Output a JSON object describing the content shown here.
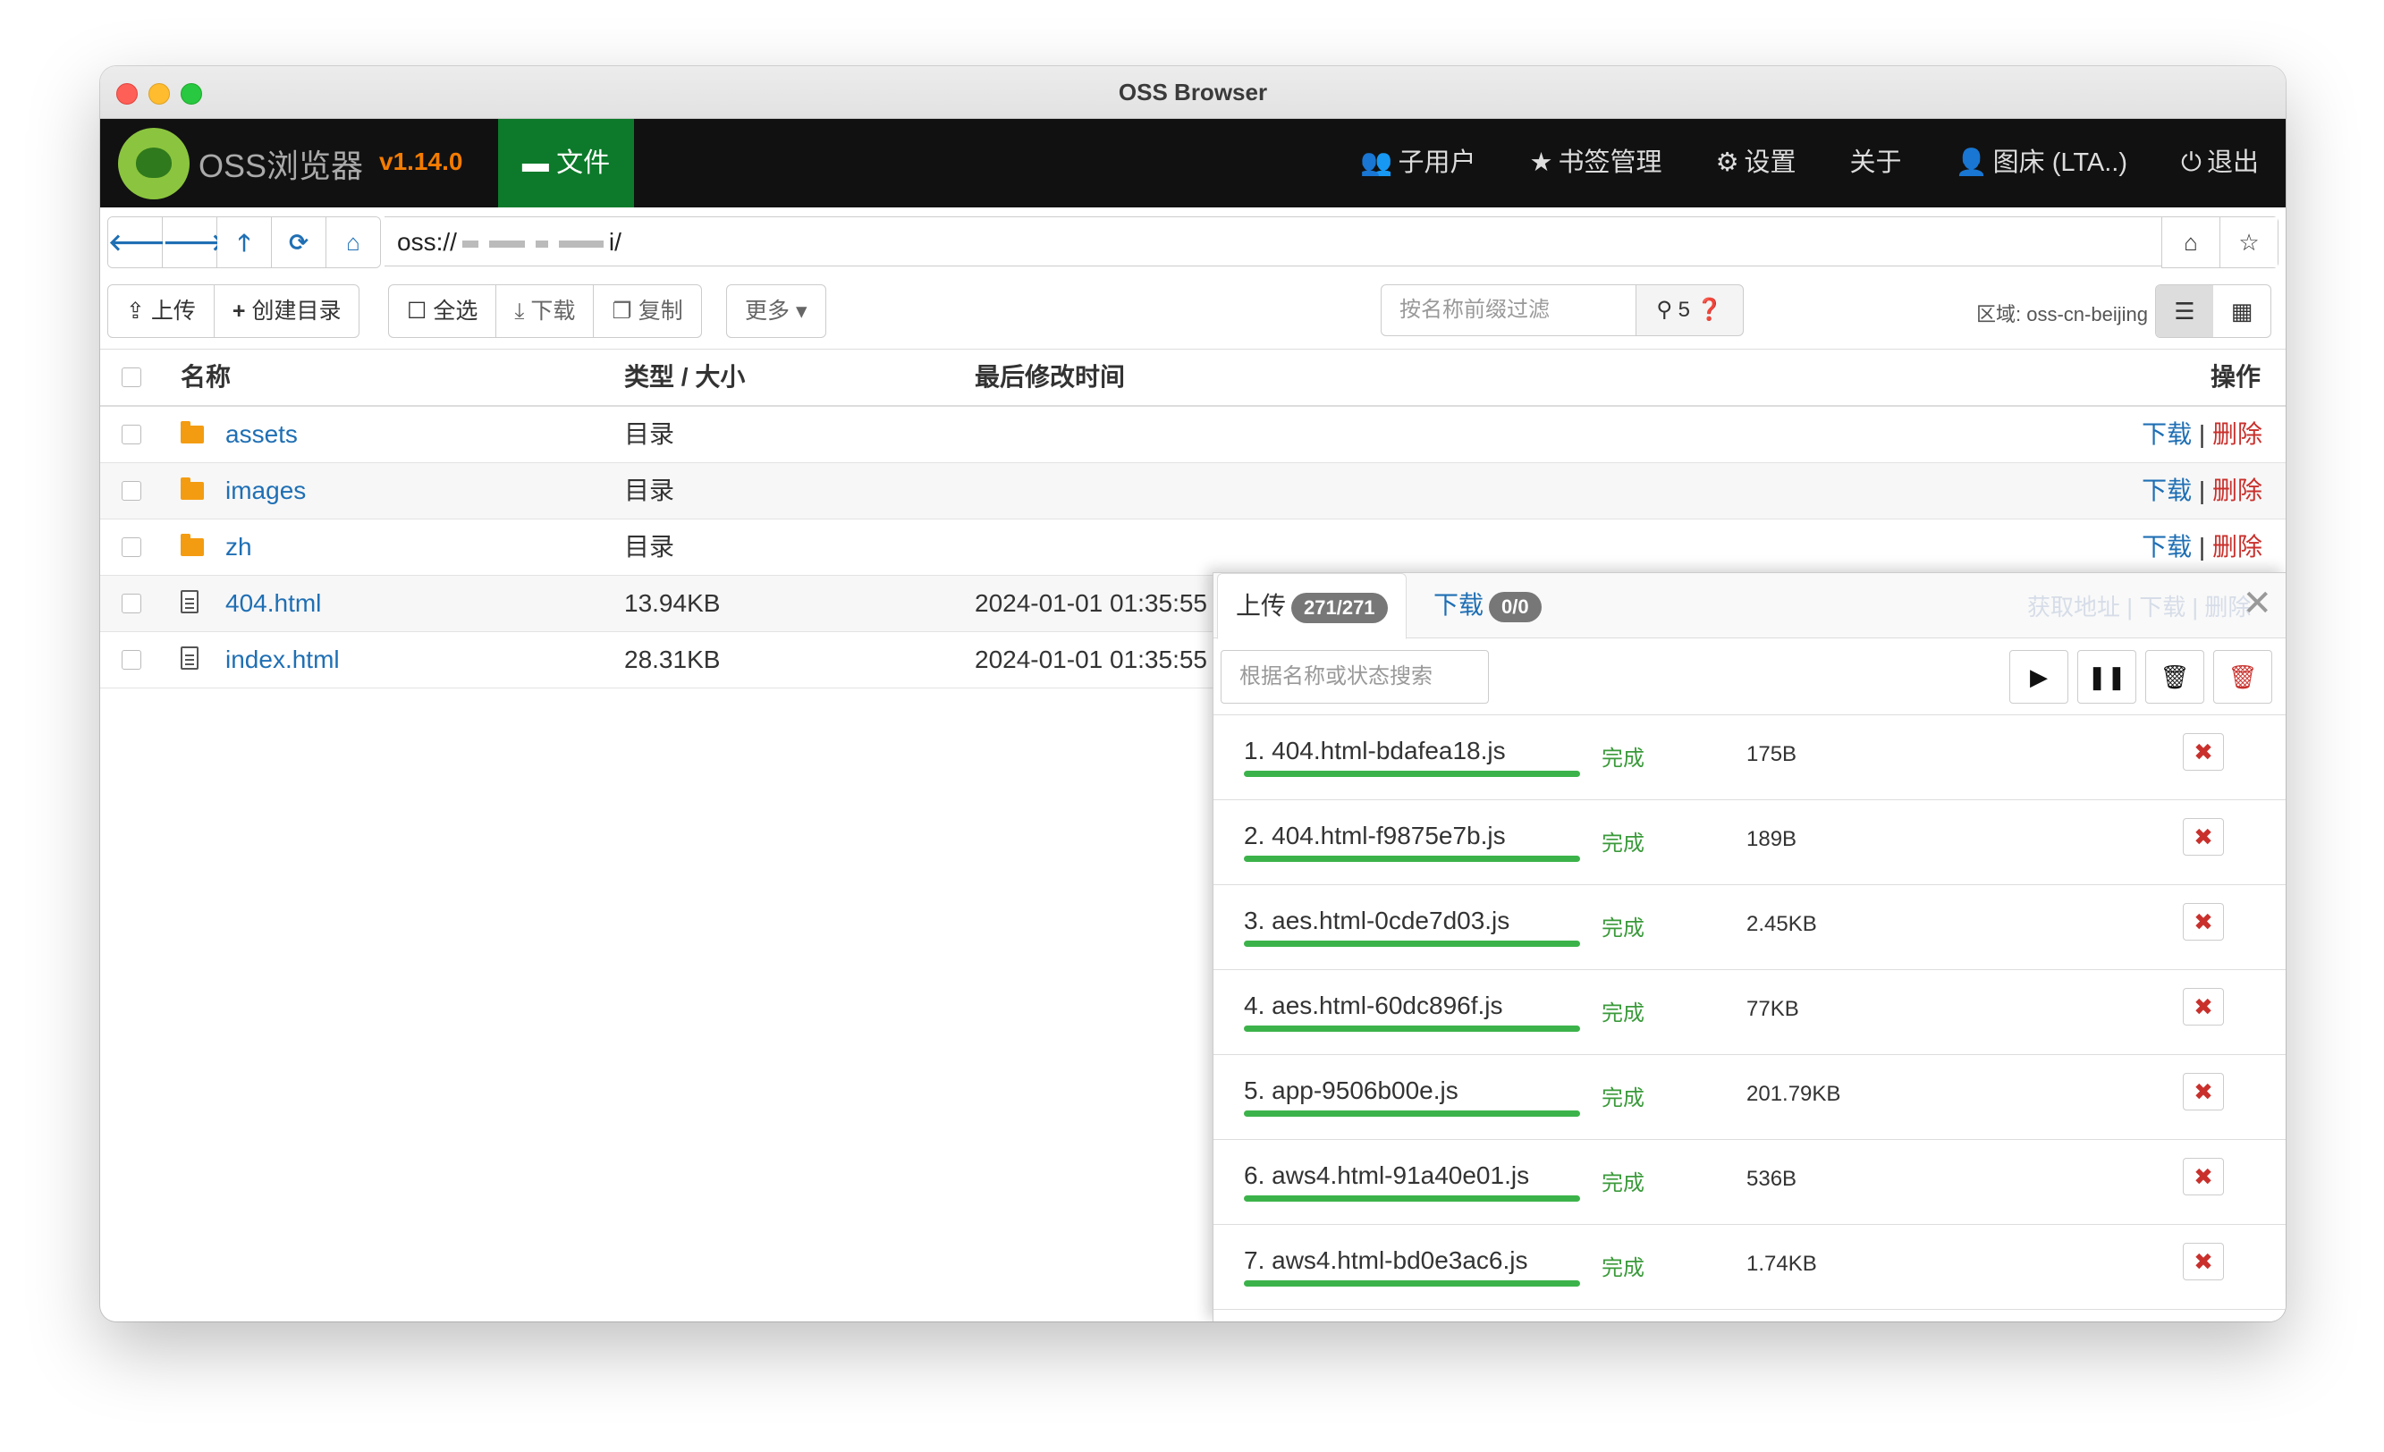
{
  "window": {
    "title": "OSS Browser"
  },
  "navbar": {
    "brand": "OSS浏览器",
    "version": "v1.14.0",
    "files_tab": "文件",
    "items": [
      {
        "icon": "users-icon",
        "label": "子用户"
      },
      {
        "icon": "star-icon",
        "label": "书签管理"
      },
      {
        "icon": "gear-icon",
        "label": "设置"
      },
      {
        "icon": "",
        "label": "关于"
      },
      {
        "icon": "user-icon",
        "label": "图床 (LTA..)"
      },
      {
        "icon": "power-icon",
        "label": "退出"
      }
    ]
  },
  "address": {
    "prefix": "oss://",
    "suffix": "i/"
  },
  "toolbar": {
    "upload": "上传",
    "mkdir": "创建目录",
    "select_all": "全选",
    "download": "下载",
    "copy": "复制",
    "more": "更多",
    "filter_placeholder": "按名称前缀过滤",
    "filter_count": "5",
    "region": "区域: oss-cn-beijing"
  },
  "table": {
    "headers": {
      "name": "名称",
      "type_size": "类型 / 大小",
      "modified": "最后修改时间",
      "ops": "操作"
    },
    "download_label": "下载",
    "delete_label": "删除",
    "separator": "|",
    "rows": [
      {
        "kind": "folder",
        "name": "assets",
        "type": "目录",
        "modified": ""
      },
      {
        "kind": "folder",
        "name": "images",
        "type": "目录",
        "modified": ""
      },
      {
        "kind": "folder",
        "name": "zh",
        "type": "目录",
        "modified": ""
      },
      {
        "kind": "file",
        "name": "404.html",
        "type": "13.94KB",
        "modified": "2024-01-01 01:35:55"
      },
      {
        "kind": "file",
        "name": "index.html",
        "type": "28.31KB",
        "modified": "2024-01-01 01:35:55"
      }
    ]
  },
  "transfer": {
    "upload_tab": "上传",
    "upload_badge": "271/271",
    "download_tab": "下载",
    "download_badge": "0/0",
    "ghost_text": "获取地址 | 下载 | 删除",
    "search_placeholder": "根据名称或状态搜索",
    "items": [
      {
        "name": "1. 404.html-bdafea18.js",
        "status": "完成",
        "size": "175B",
        "progress": 1.0
      },
      {
        "name": "2. 404.html-f9875e7b.js",
        "status": "完成",
        "size": "189B",
        "progress": 1.0
      },
      {
        "name": "3. aes.html-0cde7d03.js",
        "status": "完成",
        "size": "2.45KB",
        "progress": 1.0
      },
      {
        "name": "4. aes.html-60dc896f.js",
        "status": "完成",
        "size": "77KB",
        "progress": 1.0
      },
      {
        "name": "5. app-9506b00e.js",
        "status": "完成",
        "size": "201.79KB",
        "progress": 1.0
      },
      {
        "name": "6. aws4.html-91a40e01.js",
        "status": "完成",
        "size": "536B",
        "progress": 1.0
      },
      {
        "name": "7. aws4.html-bd0e3ac6.js",
        "status": "完成",
        "size": "1.74KB",
        "progress": 1.0
      }
    ]
  }
}
